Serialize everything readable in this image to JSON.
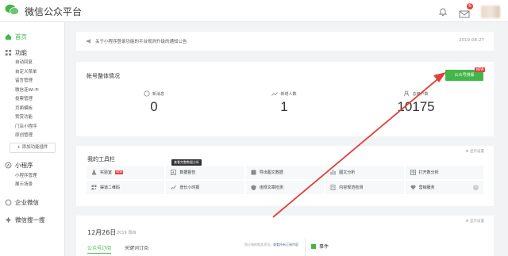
{
  "header": {
    "brand": "微信公众平台",
    "mail_badge": "6"
  },
  "sidebar": {
    "home": "首页",
    "features": "功能",
    "feature_items": [
      "自动回复",
      "自定义菜单",
      "留言管理",
      "微信连Wi-Fi",
      "投票管理",
      "页面模板",
      "赞赏功能",
      "门店小程序",
      "原创管理"
    ],
    "add_plugin": "+ 添加功能插件",
    "miniprogram": "小程序",
    "mini_items": [
      "小程序管理",
      "展示场景"
    ],
    "enterprise": "企业微信",
    "search": "微信搜一搜"
  },
  "notice": {
    "text": "关于小程序登录功能的平台规则升级的通知公告",
    "date": "2019-08-27"
  },
  "overview": {
    "title": "帐号整体情况",
    "button": "公众号排版",
    "button_tag": "NEW",
    "stats": [
      {
        "label": "新消息",
        "value": "0"
      },
      {
        "label": "新增人数",
        "value": "1"
      },
      {
        "label": "总用户数",
        "value": "10175"
      }
    ]
  },
  "toolbox": {
    "title": "我的工具栏",
    "setting": "⚙ 显示设置",
    "tooltip": "查看完整数据分析",
    "tools": [
      {
        "label": "实验室",
        "icon": "flask-icon",
        "tag": "NEW"
      },
      {
        "label": "数据报告",
        "icon": "chart-icon"
      },
      {
        "label": "导出图文数据",
        "icon": "export-icon"
      },
      {
        "label": "图文分析",
        "icon": "bar-icon"
      },
      {
        "label": "打开数分析",
        "icon": "table-icon"
      },
      {
        "label": "渠道二维码",
        "icon": "qrcode-icon"
      },
      {
        "label": "增长小时报",
        "icon": "trend-icon"
      },
      {
        "label": "违规文章检测",
        "icon": "shield-icon"
      },
      {
        "label": "内容规范检测",
        "icon": "doc-icon"
      },
      {
        "label": "营销服务",
        "icon": "heart-icon",
        "help": "?"
      }
    ]
  },
  "daily": {
    "setting": "⚙ 显示设置",
    "date": "12月26日",
    "year": "2019 周四",
    "tab_active": "公众号订阅",
    "tab_other": "关键词订阅",
    "hint_prefix": "您订阅的相关资讯，",
    "hint_link": "查看所有订阅内容",
    "event": "事件"
  },
  "colors": {
    "brand_green": "#44b549",
    "badge_red": "#e64340",
    "arrow_red": "#e0403a"
  }
}
